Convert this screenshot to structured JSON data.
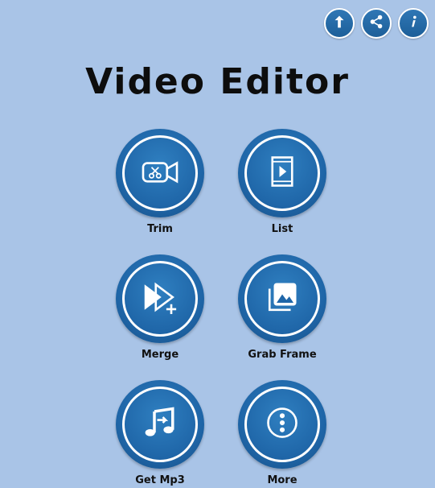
{
  "app": {
    "title": "Video Editor"
  },
  "topbar": {
    "icons": [
      "upload-icon",
      "share-icon",
      "info-icon"
    ]
  },
  "menu": {
    "items": [
      {
        "label": "Trim",
        "icon": "trim-icon"
      },
      {
        "label": "List",
        "icon": "list-icon"
      },
      {
        "label": "Merge",
        "icon": "merge-icon"
      },
      {
        "label": "Grab Frame",
        "icon": "grab-frame-icon"
      },
      {
        "label": "Get Mp3",
        "icon": "get-mp3-icon"
      },
      {
        "label": "More",
        "icon": "more-icon"
      }
    ]
  },
  "colors": {
    "background": "#a9c4e7",
    "button_blue": "#1f66a8",
    "white": "#ffffff",
    "text": "#111111"
  }
}
